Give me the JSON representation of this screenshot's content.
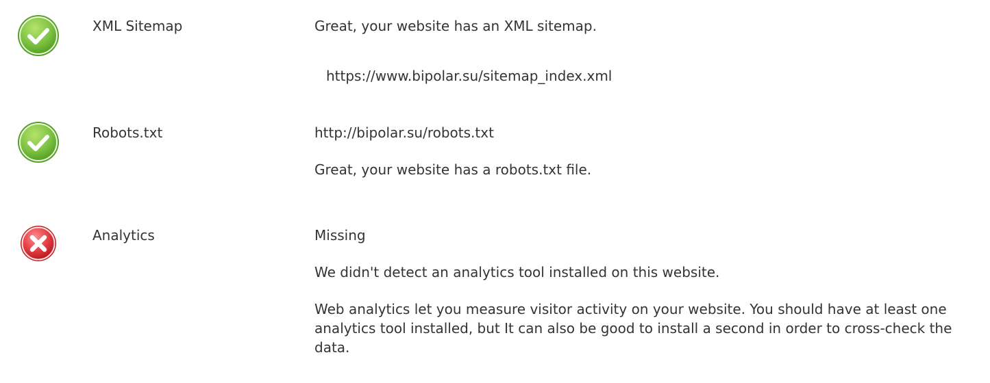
{
  "rows": [
    {
      "status": "ok",
      "status_icon": "check-circle-icon",
      "name": "XML Sitemap",
      "message": "Great, your website has an XML sitemap.",
      "code": "https://www.bipolar.su/sitemap_index.xml"
    },
    {
      "status": "ok",
      "status_icon": "check-circle-icon",
      "name": "Robots.txt",
      "url": "http://bipolar.su/robots.txt",
      "message": "Great, your website has a robots.txt file."
    },
    {
      "status": "error",
      "status_icon": "error-circle-icon",
      "name": "Analytics",
      "value": "Missing",
      "message": "We didn't detect an analytics tool installed on this website.",
      "detail": "Web analytics let you measure visitor activity on your website. You should have at least one analytics tool installed, but It can also be good to install a second in order to cross-check the data."
    }
  ],
  "colors": {
    "ok_bg": "#dff0d8",
    "error_bg": "#f2dede",
    "ok_icon": "#7cc142",
    "error_icon": "#e0393e"
  }
}
